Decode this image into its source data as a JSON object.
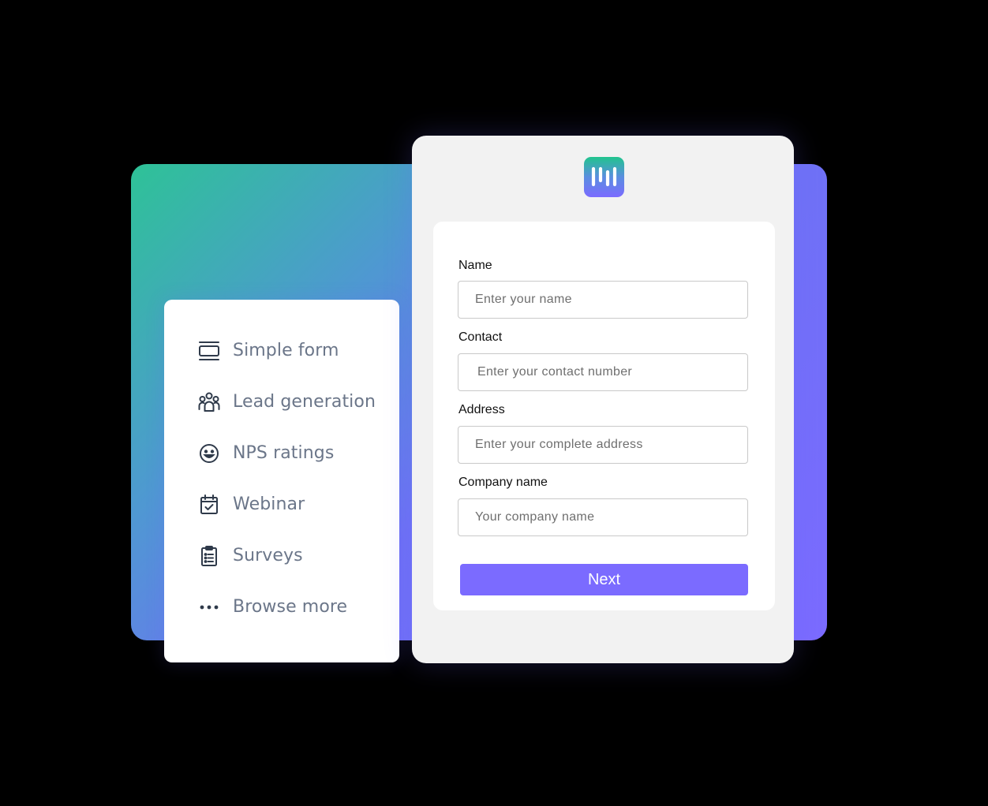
{
  "templates": {
    "items": [
      {
        "label": "Simple form",
        "icon": "simple-form-icon"
      },
      {
        "label": "Lead generation",
        "icon": "users-group-icon"
      },
      {
        "label": "NPS ratings",
        "icon": "smiley-icon"
      },
      {
        "label": "Webinar",
        "icon": "calendar-check-icon"
      },
      {
        "label": "Surveys",
        "icon": "clipboard-list-icon"
      },
      {
        "label": "Browse more",
        "icon": "more-dots-icon"
      }
    ]
  },
  "form": {
    "logo_icon": "brand-logo-icon",
    "fields": [
      {
        "label": "Name",
        "placeholder": "Enter your name"
      },
      {
        "label": "Contact",
        "placeholder": "Enter your contact number"
      },
      {
        "label": "Address",
        "placeholder": "Enter your complete address"
      },
      {
        "label": "Company name",
        "placeholder": "Your company name"
      }
    ],
    "submit_label": "Next"
  },
  "colors": {
    "background": "#000000",
    "accent": "#7b6bff",
    "gradient_start": "#2ec297",
    "menu_text": "#6b7689",
    "card_bg": "#f2f2f2"
  }
}
